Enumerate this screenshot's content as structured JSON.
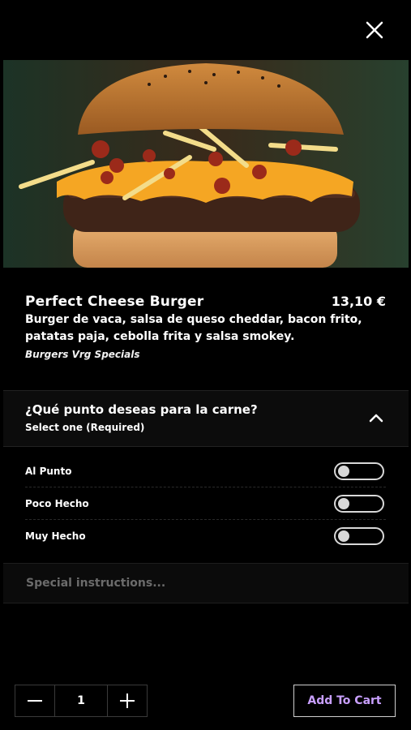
{
  "product": {
    "name": "Perfect Cheese Burger",
    "price": "13,10 €",
    "description": "Burger de vaca, salsa de queso cheddar, bacon frito, patatas paja, cebolla frita y salsa smokey.",
    "category": "Burgers Vrg Specials"
  },
  "modifier": {
    "title": "¿Qué punto deseas para la carne?",
    "subtitle": "Select one (Required)",
    "options": [
      {
        "label": "Al Punto",
        "selected": false
      },
      {
        "label": "Poco Hecho",
        "selected": false
      },
      {
        "label": "Muy Hecho",
        "selected": false
      }
    ]
  },
  "instructions": {
    "placeholder": "Special instructions..."
  },
  "cart": {
    "quantity": "1",
    "add_label": "Add To Cart"
  },
  "colors": {
    "background": "#000000",
    "add_button_text": "#c9a0ff",
    "toggle": "#d8d8d8"
  },
  "icons": {
    "close": "close-icon",
    "collapse": "chevron-up-icon",
    "minus": "minus-icon",
    "plus": "plus-icon"
  }
}
